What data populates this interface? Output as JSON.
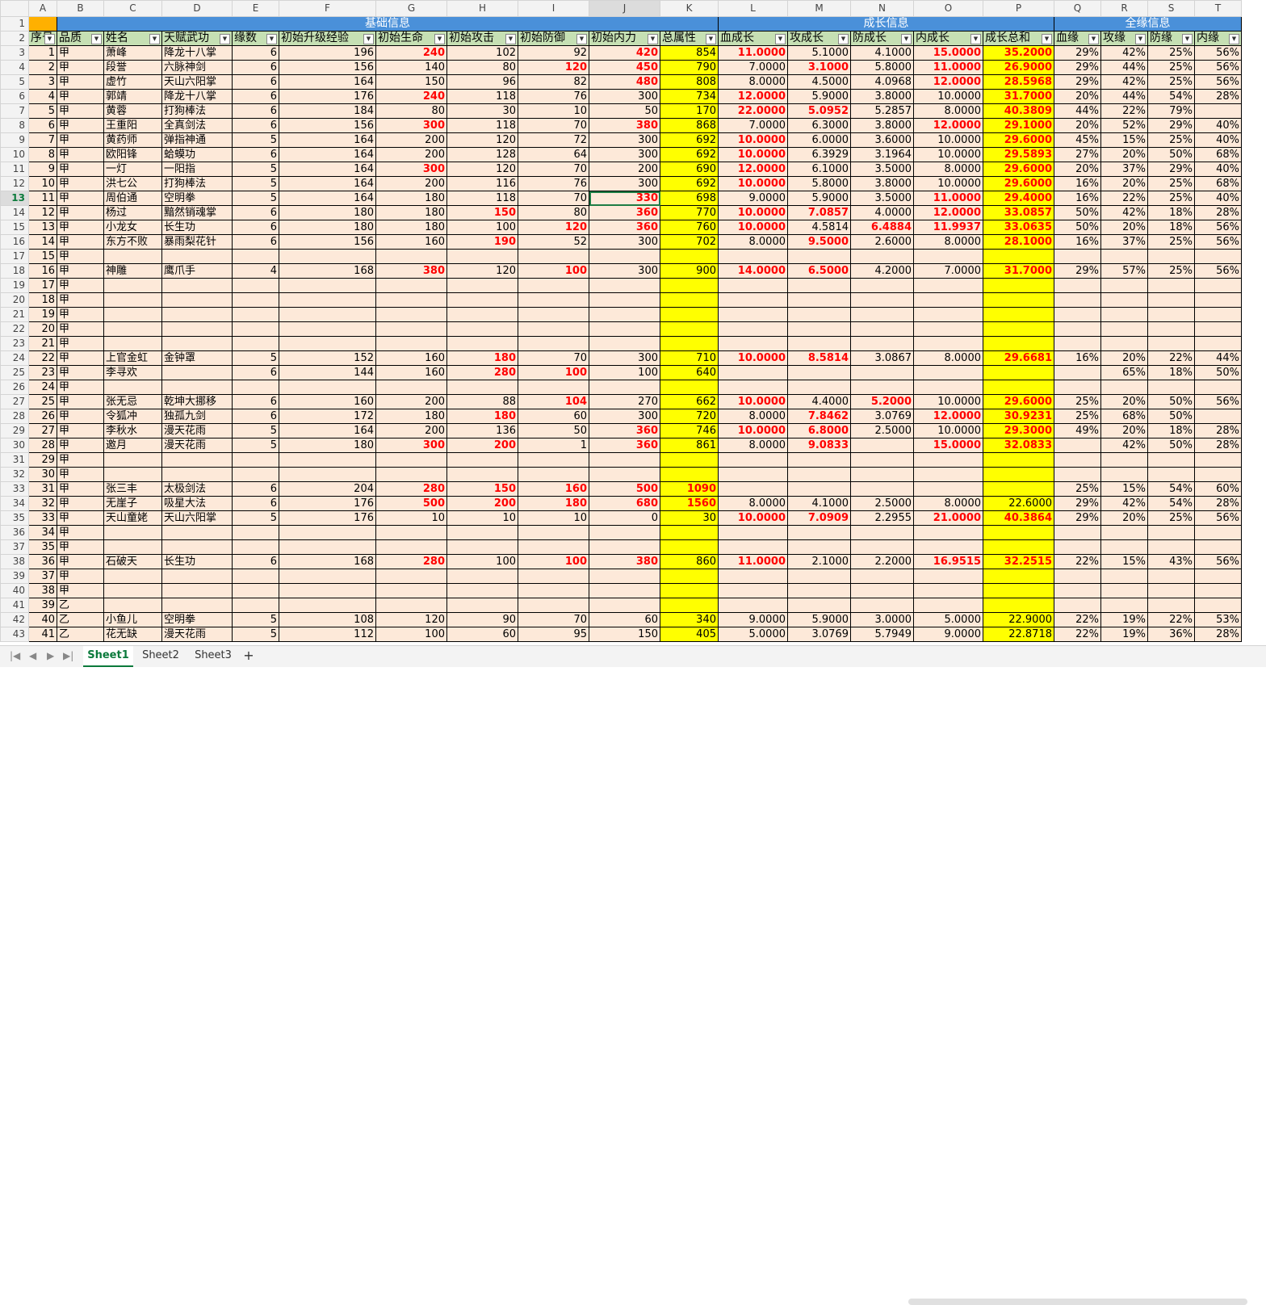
{
  "columns": [
    "A",
    "B",
    "C",
    "D",
    "E",
    "F",
    "G",
    "H",
    "I",
    "J",
    "K",
    "L",
    "M",
    "N",
    "O",
    "P",
    "Q",
    "R",
    "S",
    "T"
  ],
  "selected_column": "J",
  "selected_row": "13",
  "groups": [
    {
      "label": "基础信息",
      "span": 11
    },
    {
      "label": "成长信息",
      "span": 5
    },
    {
      "label": "全缘信息",
      "span": 4
    }
  ],
  "headers": [
    "序号",
    "品质",
    "姓名",
    "天赋武功",
    "缘数",
    "初始升级经验",
    "初始生命",
    "初始攻击",
    "初始防御",
    "初始内力",
    "总属性",
    "血成长",
    "攻成长",
    "防成长",
    "内成长",
    "成长总和",
    "血缘",
    "攻缘",
    "防缘",
    "内缘"
  ],
  "filter_glyph": "▼",
  "rows": [
    {
      "n": "3",
      "c": [
        "1",
        "甲",
        "萧峰",
        "降龙十八掌",
        "6",
        "196",
        "240",
        "102",
        "92",
        "420",
        "854",
        "11.0000",
        "5.1000",
        "4.1000",
        "15.0000",
        "35.2000",
        "29%",
        "42%",
        "25%",
        "56%"
      ]
    },
    {
      "n": "4",
      "c": [
        "2",
        "甲",
        "段誉",
        "六脉神剑",
        "6",
        "156",
        "140",
        "80",
        "120",
        "450",
        "790",
        "7.0000",
        "3.1000",
        "5.8000",
        "11.0000",
        "26.9000",
        "29%",
        "44%",
        "25%",
        "56%"
      ]
    },
    {
      "n": "5",
      "c": [
        "3",
        "甲",
        "虚竹",
        "天山六阳掌",
        "6",
        "164",
        "150",
        "96",
        "82",
        "480",
        "808",
        "8.0000",
        "4.5000",
        "4.0968",
        "12.0000",
        "28.5968",
        "29%",
        "42%",
        "25%",
        "56%"
      ]
    },
    {
      "n": "6",
      "c": [
        "4",
        "甲",
        "郭靖",
        "降龙十八掌",
        "6",
        "176",
        "240",
        "118",
        "76",
        "300",
        "734",
        "12.0000",
        "5.9000",
        "3.8000",
        "10.0000",
        "31.7000",
        "20%",
        "44%",
        "54%",
        "28%"
      ]
    },
    {
      "n": "7",
      "c": [
        "5",
        "甲",
        "黄蓉",
        "打狗棒法",
        "6",
        "184",
        "80",
        "30",
        "10",
        "50",
        "170",
        "22.0000",
        "5.0952",
        "5.2857",
        "8.0000",
        "40.3809",
        "44%",
        "22%",
        "79%",
        ""
      ]
    },
    {
      "n": "8",
      "c": [
        "6",
        "甲",
        "王重阳",
        "全真剑法",
        "6",
        "156",
        "300",
        "118",
        "70",
        "380",
        "868",
        "7.0000",
        "6.3000",
        "3.8000",
        "12.0000",
        "29.1000",
        "20%",
        "52%",
        "29%",
        "40%"
      ]
    },
    {
      "n": "9",
      "c": [
        "7",
        "甲",
        "黄药师",
        "弹指神通",
        "5",
        "164",
        "200",
        "120",
        "72",
        "300",
        "692",
        "10.0000",
        "6.0000",
        "3.6000",
        "10.0000",
        "29.6000",
        "45%",
        "15%",
        "25%",
        "40%"
      ]
    },
    {
      "n": "10",
      "c": [
        "8",
        "甲",
        "欧阳锋",
        "蛤蟆功",
        "6",
        "164",
        "200",
        "128",
        "64",
        "300",
        "692",
        "10.0000",
        "6.3929",
        "3.1964",
        "10.0000",
        "29.5893",
        "27%",
        "20%",
        "50%",
        "68%"
      ]
    },
    {
      "n": "11",
      "c": [
        "9",
        "甲",
        "一灯",
        "一阳指",
        "5",
        "164",
        "300",
        "120",
        "70",
        "200",
        "690",
        "12.0000",
        "6.1000",
        "3.5000",
        "8.0000",
        "29.6000",
        "20%",
        "37%",
        "29%",
        "40%"
      ]
    },
    {
      "n": "12",
      "c": [
        "10",
        "甲",
        "洪七公",
        "打狗棒法",
        "5",
        "164",
        "200",
        "116",
        "76",
        "300",
        "692",
        "10.0000",
        "5.8000",
        "3.8000",
        "10.0000",
        "29.6000",
        "16%",
        "20%",
        "25%",
        "68%"
      ]
    },
    {
      "n": "13",
      "c": [
        "11",
        "甲",
        "周伯通",
        "空明拳",
        "5",
        "164",
        "180",
        "118",
        "70",
        "330",
        "698",
        "9.0000",
        "5.9000",
        "3.5000",
        "11.0000",
        "29.4000",
        "16%",
        "22%",
        "25%",
        "40%"
      ]
    },
    {
      "n": "14",
      "c": [
        "12",
        "甲",
        "杨过",
        "黯然销魂掌",
        "6",
        "180",
        "180",
        "150",
        "80",
        "360",
        "770",
        "10.0000",
        "7.0857",
        "4.0000",
        "12.0000",
        "33.0857",
        "50%",
        "42%",
        "18%",
        "28%"
      ]
    },
    {
      "n": "15",
      "c": [
        "13",
        "甲",
        "小龙女",
        "长生功",
        "6",
        "180",
        "180",
        "100",
        "120",
        "360",
        "760",
        "10.0000",
        "4.5814",
        "6.4884",
        "11.9937",
        "33.0635",
        "50%",
        "20%",
        "18%",
        "56%"
      ]
    },
    {
      "n": "16",
      "c": [
        "14",
        "甲",
        "东方不败",
        "暴雨梨花针",
        "6",
        "156",
        "160",
        "190",
        "52",
        "300",
        "702",
        "8.0000",
        "9.5000",
        "2.6000",
        "8.0000",
        "28.1000",
        "16%",
        "37%",
        "25%",
        "56%"
      ]
    },
    {
      "n": "17",
      "c": [
        "15",
        "甲",
        "",
        "",
        "",
        "",
        "",
        "",
        "",
        "",
        "",
        "",
        "",
        "",
        "",
        "",
        "",
        "",
        "",
        ""
      ]
    },
    {
      "n": "18",
      "c": [
        "16",
        "甲",
        "神雕",
        "鹰爪手",
        "4",
        "168",
        "380",
        "120",
        "100",
        "300",
        "900",
        "14.0000",
        "6.5000",
        "4.2000",
        "7.0000",
        "31.7000",
        "29%",
        "57%",
        "25%",
        "56%"
      ]
    },
    {
      "n": "19",
      "c": [
        "17",
        "甲",
        "",
        "",
        "",
        "",
        "",
        "",
        "",
        "",
        "",
        "",
        "",
        "",
        "",
        "",
        "",
        "",
        "",
        ""
      ]
    },
    {
      "n": "20",
      "c": [
        "18",
        "甲",
        "",
        "",
        "",
        "",
        "",
        "",
        "",
        "",
        "",
        "",
        "",
        "",
        "",
        "",
        "",
        "",
        "",
        ""
      ]
    },
    {
      "n": "21",
      "c": [
        "19",
        "甲",
        "",
        "",
        "",
        "",
        "",
        "",
        "",
        "",
        "",
        "",
        "",
        "",
        "",
        "",
        "",
        "",
        "",
        ""
      ]
    },
    {
      "n": "22",
      "c": [
        "20",
        "甲",
        "",
        "",
        "",
        "",
        "",
        "",
        "",
        "",
        "",
        "",
        "",
        "",
        "",
        "",
        "",
        "",
        "",
        ""
      ]
    },
    {
      "n": "23",
      "c": [
        "21",
        "甲",
        "",
        "",
        "",
        "",
        "",
        "",
        "",
        "",
        "",
        "",
        "",
        "",
        "",
        "",
        "",
        "",
        "",
        ""
      ]
    },
    {
      "n": "24",
      "c": [
        "22",
        "甲",
        "上官金虹",
        "金钟罩",
        "5",
        "152",
        "160",
        "180",
        "70",
        "300",
        "710",
        "10.0000",
        "8.5814",
        "3.0867",
        "8.0000",
        "29.6681",
        "16%",
        "20%",
        "22%",
        "44%"
      ]
    },
    {
      "n": "25",
      "c": [
        "23",
        "甲",
        "李寻欢",
        "",
        "6",
        "144",
        "160",
        "280",
        "100",
        "100",
        "640",
        "",
        "",
        "",
        "",
        "",
        "",
        "65%",
        "18%",
        "50%"
      ]
    },
    {
      "n": "26",
      "c": [
        "24",
        "甲",
        "",
        "",
        "",
        "",
        "",
        "",
        "",
        "",
        "",
        "",
        "",
        "",
        "",
        "",
        "",
        "",
        "",
        ""
      ]
    },
    {
      "n": "27",
      "c": [
        "25",
        "甲",
        "张无忌",
        "乾坤大挪移",
        "6",
        "160",
        "200",
        "88",
        "104",
        "270",
        "662",
        "10.0000",
        "4.4000",
        "5.2000",
        "10.0000",
        "29.6000",
        "25%",
        "20%",
        "50%",
        "56%"
      ]
    },
    {
      "n": "28",
      "c": [
        "26",
        "甲",
        "令狐冲",
        "独孤九剑",
        "6",
        "172",
        "180",
        "180",
        "60",
        "300",
        "720",
        "8.0000",
        "7.8462",
        "3.0769",
        "12.0000",
        "30.9231",
        "25%",
        "68%",
        "50%",
        ""
      ]
    },
    {
      "n": "29",
      "c": [
        "27",
        "甲",
        "李秋水",
        "漫天花雨",
        "5",
        "164",
        "200",
        "136",
        "50",
        "360",
        "746",
        "10.0000",
        "6.8000",
        "2.5000",
        "10.0000",
        "29.3000",
        "49%",
        "20%",
        "18%",
        "28%"
      ]
    },
    {
      "n": "30",
      "c": [
        "28",
        "甲",
        "邀月",
        "漫天花雨",
        "5",
        "180",
        "300",
        "200",
        "1",
        "360",
        "861",
        "8.0000",
        "9.0833",
        "",
        "15.0000",
        "32.0833",
        "",
        "42%",
        "50%",
        "28%"
      ]
    },
    {
      "n": "31",
      "c": [
        "29",
        "甲",
        "",
        "",
        "",
        "",
        "",
        "",
        "",
        "",
        "",
        "",
        "",
        "",
        "",
        "",
        "",
        "",
        "",
        ""
      ]
    },
    {
      "n": "32",
      "c": [
        "30",
        "甲",
        "",
        "",
        "",
        "",
        "",
        "",
        "",
        "",
        "",
        "",
        "",
        "",
        "",
        "",
        "",
        "",
        "",
        ""
      ]
    },
    {
      "n": "33",
      "c": [
        "31",
        "甲",
        "张三丰",
        "太极剑法",
        "6",
        "204",
        "280",
        "150",
        "160",
        "500",
        "1090",
        "",
        "",
        "",
        "",
        "",
        "25%",
        "15%",
        "54%",
        "60%"
      ]
    },
    {
      "n": "34",
      "c": [
        "32",
        "甲",
        "无崖子",
        "吸星大法",
        "6",
        "176",
        "500",
        "200",
        "180",
        "680",
        "1560",
        "8.0000",
        "4.1000",
        "2.5000",
        "8.0000",
        "22.6000",
        "29%",
        "42%",
        "54%",
        "28%"
      ]
    },
    {
      "n": "35",
      "c": [
        "33",
        "甲",
        "天山童姥",
        "天山六阳掌",
        "5",
        "176",
        "10",
        "10",
        "10",
        "0",
        "30",
        "10.0000",
        "7.0909",
        "2.2955",
        "21.0000",
        "40.3864",
        "29%",
        "20%",
        "25%",
        "56%"
      ]
    },
    {
      "n": "36",
      "c": [
        "34",
        "甲",
        "",
        "",
        "",
        "",
        "",
        "",
        "",
        "",
        "",
        "",
        "",
        "",
        "",
        "",
        "",
        "",
        "",
        ""
      ]
    },
    {
      "n": "37",
      "c": [
        "35",
        "甲",
        "",
        "",
        "",
        "",
        "",
        "",
        "",
        "",
        "",
        "",
        "",
        "",
        "",
        "",
        "",
        "",
        "",
        ""
      ]
    },
    {
      "n": "38",
      "c": [
        "36",
        "甲",
        "石破天",
        "长生功",
        "6",
        "168",
        "280",
        "100",
        "100",
        "380",
        "860",
        "11.0000",
        "2.1000",
        "2.2000",
        "16.9515",
        "32.2515",
        "22%",
        "15%",
        "43%",
        "56%"
      ]
    },
    {
      "n": "39",
      "c": [
        "37",
        "甲",
        "",
        "",
        "",
        "",
        "",
        "",
        "",
        "",
        "",
        "",
        "",
        "",
        "",
        "",
        "",
        "",
        "",
        ""
      ]
    },
    {
      "n": "40",
      "c": [
        "38",
        "甲",
        "",
        "",
        "",
        "",
        "",
        "",
        "",
        "",
        "",
        "",
        "",
        "",
        "",
        "",
        "",
        "",
        "",
        ""
      ]
    },
    {
      "n": "41",
      "c": [
        "39",
        "乙",
        "",
        "",
        "",
        "",
        "",
        "",
        "",
        "",
        "",
        "",
        "",
        "",
        "",
        "",
        "",
        "",
        "",
        ""
      ]
    },
    {
      "n": "42",
      "c": [
        "40",
        "乙",
        "小鱼儿",
        "空明拳",
        "5",
        "108",
        "120",
        "90",
        "70",
        "60",
        "340",
        "9.0000",
        "5.9000",
        "3.0000",
        "5.0000",
        "22.9000",
        "22%",
        "19%",
        "22%",
        "53%"
      ]
    },
    {
      "n": "43",
      "c": [
        "41",
        "乙",
        "花无缺",
        "漫天花雨",
        "5",
        "112",
        "100",
        "60",
        "95",
        "150",
        "405",
        "5.0000",
        "3.0769",
        "5.7949",
        "9.0000",
        "22.8718",
        "22%",
        "19%",
        "36%",
        "28%"
      ]
    }
  ],
  "tabs": [
    "Sheet1",
    "Sheet2",
    "Sheet3"
  ],
  "active_tab": "Sheet1",
  "add_sheet": "+",
  "nav_glyphs": [
    "|◀",
    "◀",
    "▶",
    "▶|"
  ]
}
